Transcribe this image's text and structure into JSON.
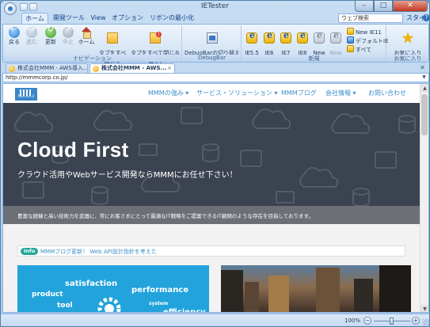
{
  "app": {
    "title": "IETester"
  },
  "ribbon_tabs": [
    "ホーム",
    "開発ツール",
    "View",
    "オプション",
    "リボンの最小化"
  ],
  "search": {
    "placeholder": "ウェブ検索"
  },
  "style_menu": "スタイル ▾",
  "help": "?",
  "navigation_group": {
    "label": "ナビゲーション",
    "back": "戻る",
    "forward": "進む",
    "refresh": "更新",
    "stop": "中止",
    "home": "ホーム",
    "close_all_tabs": "タブをすべて\n閉じる",
    "close_all_active_tabs": "タブをすべて閉じる\n(アクティブタブを除く)"
  },
  "debugbar_group": {
    "label": "DebugBar",
    "toggle": "DebugBarの切り替え\n(Alt+B) ▾"
  },
  "new_group": {
    "label": "新規",
    "versions": [
      "IE5.5",
      "IE6",
      "IE7",
      "IE8",
      "New\nIE9",
      "New\nIE10"
    ],
    "new_ie11": "New IE11",
    "default_ie": "デフォルトIE",
    "all": "すべて"
  },
  "favorites_group": {
    "label": "お気に入り",
    "add": "お気に入り\n▾"
  },
  "doc_tabs": [
    {
      "label": "株式会社MMM - AWS導入..."
    },
    {
      "label": "株式会社MMM - AWS..."
    }
  ],
  "address": {
    "url": "http://mmmcorp.co.jp/"
  },
  "site": {
    "logo": "MMMCO",
    "nav": [
      "MMMの強み ▾",
      "サービス・ソリューション ▾",
      "MMMブログ",
      "会社情報 ▾",
      "お問い合わせ"
    ],
    "hero_title": "Cloud First",
    "hero_subtitle": "クラウド活用やWebサービス開発ならMMMにお任せ下さい！",
    "hero_band": "豊富な経験と高い技術力を武器に、常にお客さまにとって最適なIT戦略をご提案できるIT顧問のような存在を目指しております。",
    "info_badge": "Info",
    "info_link": "MMMブログ更新！ Web API設計指針を考えた",
    "word_cloud": [
      "satisfaction",
      "product",
      "performance",
      "tool",
      "system",
      "efficiency"
    ]
  },
  "status": {
    "zoom": "100%"
  },
  "colors": {
    "accent": "#3e8fc8",
    "hero_bg": "#3b4250",
    "badge": "#26a69a",
    "card_blue": "#22a3dc"
  }
}
